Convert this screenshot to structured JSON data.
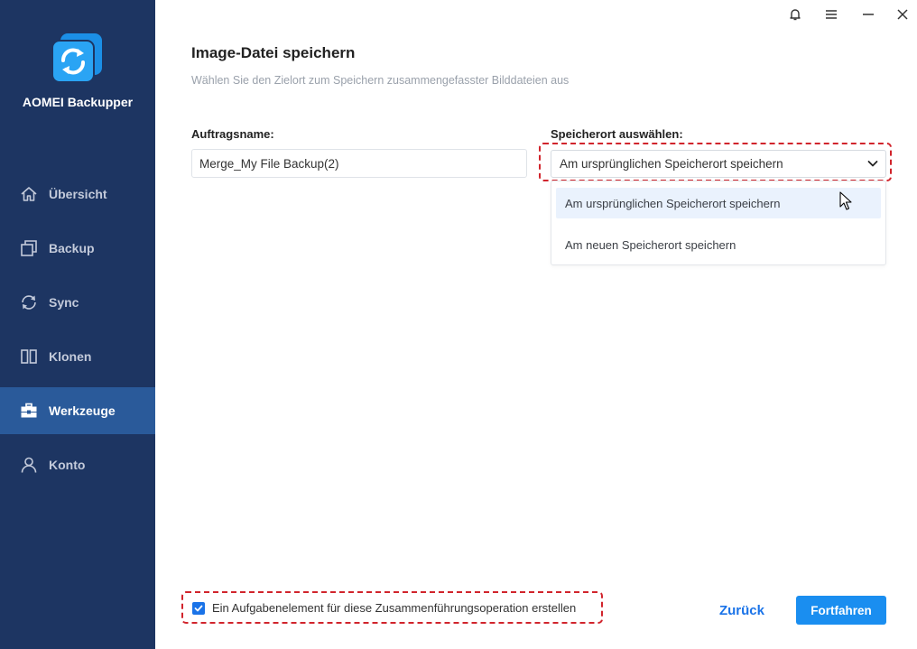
{
  "app": {
    "name": "AOMEI Backupper"
  },
  "sidebar": {
    "items": [
      {
        "label": "Übersicht",
        "icon": "home-icon"
      },
      {
        "label": "Backup",
        "icon": "backup-icon"
      },
      {
        "label": "Sync",
        "icon": "sync-icon"
      },
      {
        "label": "Klonen",
        "icon": "clone-icon"
      },
      {
        "label": "Werkzeuge",
        "icon": "tools-icon",
        "active": true
      },
      {
        "label": "Konto",
        "icon": "user-icon"
      }
    ]
  },
  "window_controls": [
    "bell-icon",
    "menu-icon",
    "minimize-icon",
    "close-icon"
  ],
  "main": {
    "title": "Image-Datei speichern",
    "subtitle": "Wählen Sie den Zielort zum Speichern zusammengefasster Bilddateien aus",
    "task_name_label": "Auftragsname:",
    "task_name_value": "Merge_My File Backup(2)",
    "location_label": "Speicherort auswählen:",
    "location_selected": "Am ursprünglichen Speicherort speichern",
    "location_options": [
      "Am ursprünglichen Speicherort speichern",
      "Am neuen Speicherort speichern"
    ]
  },
  "footer": {
    "checkbox_label": "Ein Aufgabenelement für diese Zusammenführungsoperation erstellen",
    "checkbox_checked": true,
    "back_label": "Zurück",
    "next_label": "Fortfahren"
  },
  "colors": {
    "sidebar_bg": "#1d3562",
    "sidebar_active": "#2a5a9a",
    "accent": "#1a73e8",
    "primary_button": "#1a8ef0",
    "highlight_frame": "#d1242c"
  }
}
